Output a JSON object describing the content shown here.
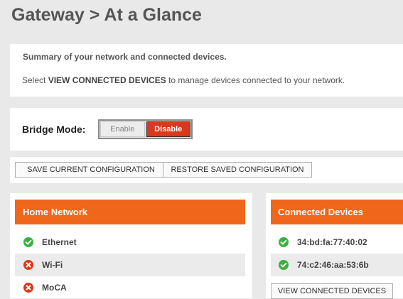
{
  "page": {
    "title": "Gateway > At a Glance"
  },
  "summary": {
    "line1": "Summary of your network and connected devices.",
    "line2_prefix": "Select ",
    "line2_highlight": "VIEW CONNECTED DEVICES",
    "line2_suffix": " to manage devices connected to your network."
  },
  "bridge_mode": {
    "label": "Bridge Mode:",
    "enable_label": "Enable",
    "disable_label": "Disable",
    "selected": "Disable"
  },
  "config_buttons": {
    "save_label": "SAVE CURRENT CONFIGURATION",
    "restore_label": "RESTORE SAVED CONFIGURATION"
  },
  "home_network": {
    "title": "Home Network",
    "items": [
      {
        "label": "Ethernet",
        "status": "connected",
        "icon": "check-icon"
      },
      {
        "label": "Wi-Fi",
        "status": "disconnected",
        "icon": "x-icon"
      },
      {
        "label": "MoCA",
        "status": "disconnected",
        "icon": "x-icon"
      }
    ]
  },
  "connected_devices": {
    "title": "Connected Devices",
    "items": [
      {
        "label": "34:bd:fa:77:40:02",
        "status": "connected",
        "icon": "check-icon"
      },
      {
        "label": "74:c2:46:aa:53:6b",
        "status": "connected",
        "icon": "check-icon"
      }
    ],
    "view_button_label": "VIEW CONNECTED DEVICES"
  },
  "colors": {
    "accent_orange": "#f0661a",
    "disable_red": "#d9391a",
    "status_green": "#3ab03e",
    "status_red": "#d9391a"
  }
}
